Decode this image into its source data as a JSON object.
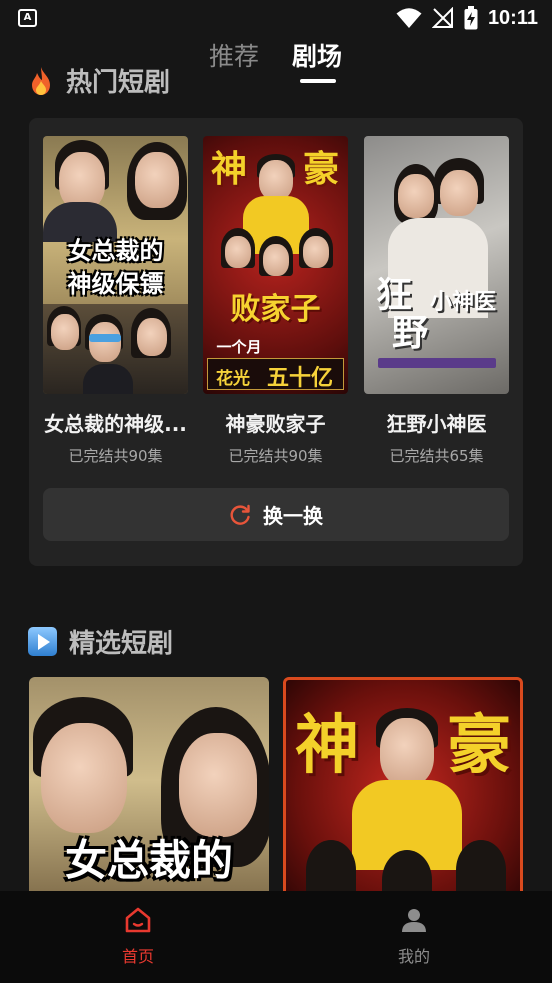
{
  "status_bar": {
    "time": "10:11",
    "left_icon_text": "A"
  },
  "top_tabs": {
    "recommend": "推荐",
    "theater": "剧场"
  },
  "hot_section": {
    "title": "热门短剧",
    "items": [
      {
        "title": "女总裁的神级...",
        "subtitle": "已完结共90集",
        "poster_text_1": "女总裁的",
        "poster_text_2": "神级保镖"
      },
      {
        "title": "神豪败家子",
        "subtitle": "已完结共90集",
        "poster_text_1": "神",
        "poster_text_2": "豪",
        "poster_text_3": "败家子",
        "poster_text_4": "一个月",
        "poster_text_5": "花光",
        "poster_text_6": "五十亿"
      },
      {
        "title": "狂野小神医",
        "subtitle": "已完结共65集",
        "poster_text_1": "狂",
        "poster_text_2": "小神医",
        "poster_text_3": "野"
      }
    ],
    "refresh_label": "换一换"
  },
  "featured_section": {
    "title": "精选短剧",
    "items": [
      {
        "poster_text": "女总裁的"
      },
      {
        "poster_text_1": "神",
        "poster_text_2": "豪"
      }
    ]
  },
  "bottom_nav": {
    "home_label": "首页",
    "mine_label": "我的",
    "active_color": "#e8392f",
    "inactive_color": "#8d8d8d"
  },
  "icons": {
    "hot": "flame-icon",
    "featured": "play-icon",
    "refresh": "refresh-icon",
    "home": "home-icon",
    "mine": "user-icon"
  }
}
